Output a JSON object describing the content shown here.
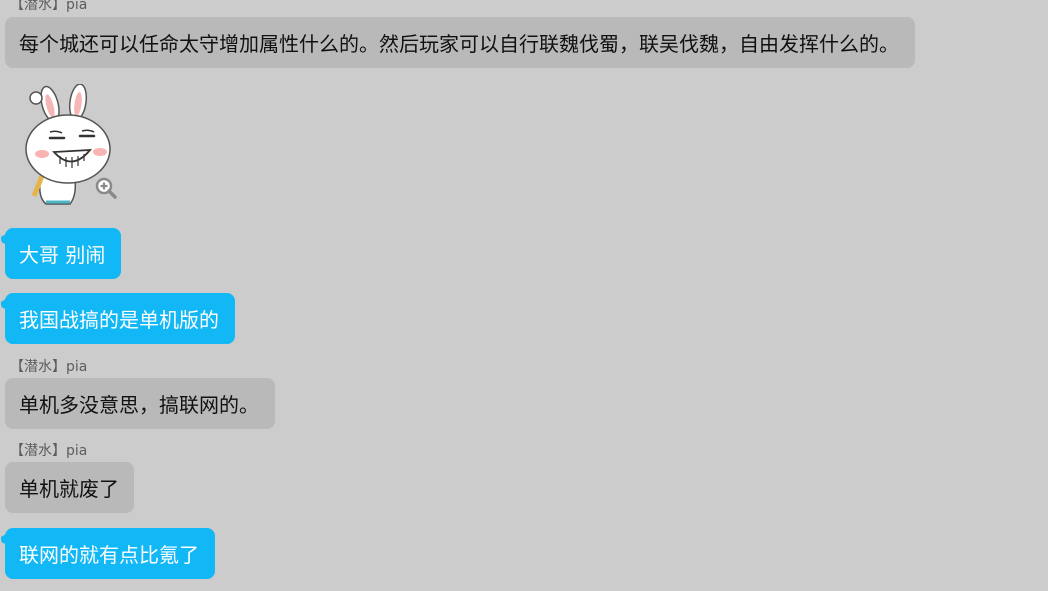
{
  "messages": [
    {
      "type": "incoming",
      "sender": "【潜水】pia",
      "text": "每个城还可以任命太守增加属性什么的。然后玩家可以自行联魏伐蜀，联吴伐魏，自由发挥什么的。"
    },
    {
      "type": "sticker",
      "icon": "rabbit-sticker",
      "action_icon": "zoom-in-icon"
    },
    {
      "type": "outgoing",
      "text": "大哥 别闹"
    },
    {
      "type": "outgoing",
      "text": "我国战搞的是单机版的"
    },
    {
      "type": "incoming",
      "sender": "【潜水】pia",
      "text": "单机多没意思，搞联网的。"
    },
    {
      "type": "incoming",
      "sender": "【潜水】pia",
      "text": "单机就废了"
    },
    {
      "type": "outgoing",
      "text": "联网的就有点比氪了"
    }
  ],
  "colors": {
    "background": "#cccccc",
    "incoming_bubble": "#b9b9b9",
    "outgoing_bubble": "#12b7f5",
    "sender_text": "#5d5d5d"
  }
}
